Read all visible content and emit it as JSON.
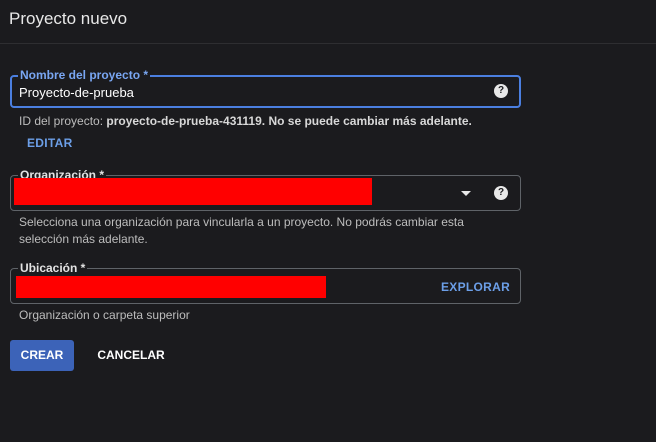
{
  "dialog": {
    "title": "Proyecto nuevo"
  },
  "project_name": {
    "label": "Nombre del proyecto *",
    "value": "Proyecto-de-prueba",
    "help_icon": "help-circle-icon",
    "id_prefix": "ID del proyecto: ",
    "id_value": "proyecto-de-prueba-431119. No se puede cambiar más adelante.",
    "edit_label": "EDITAR"
  },
  "organization": {
    "label": "Organización *",
    "value_redacted": true,
    "dropdown_icon": "caret-down-icon",
    "help_icon": "help-circle-icon",
    "hint_line1": "Selecciona una organización para vincularla a un proyecto. No podrás cambiar esta",
    "hint_line2": "selección más adelante."
  },
  "location": {
    "label": "Ubicación *",
    "value_redacted": true,
    "browse_label": "EXPLORAR",
    "hint": "Organización o carpeta superior"
  },
  "actions": {
    "create_label": "CREAR",
    "cancel_label": "CANCELAR"
  },
  "colors": {
    "background": "#1b1b1e",
    "accent": "#4b7fe0",
    "primary_button": "#3c63b8",
    "link": "#6c9fe8",
    "redaction": "#ff0000"
  }
}
